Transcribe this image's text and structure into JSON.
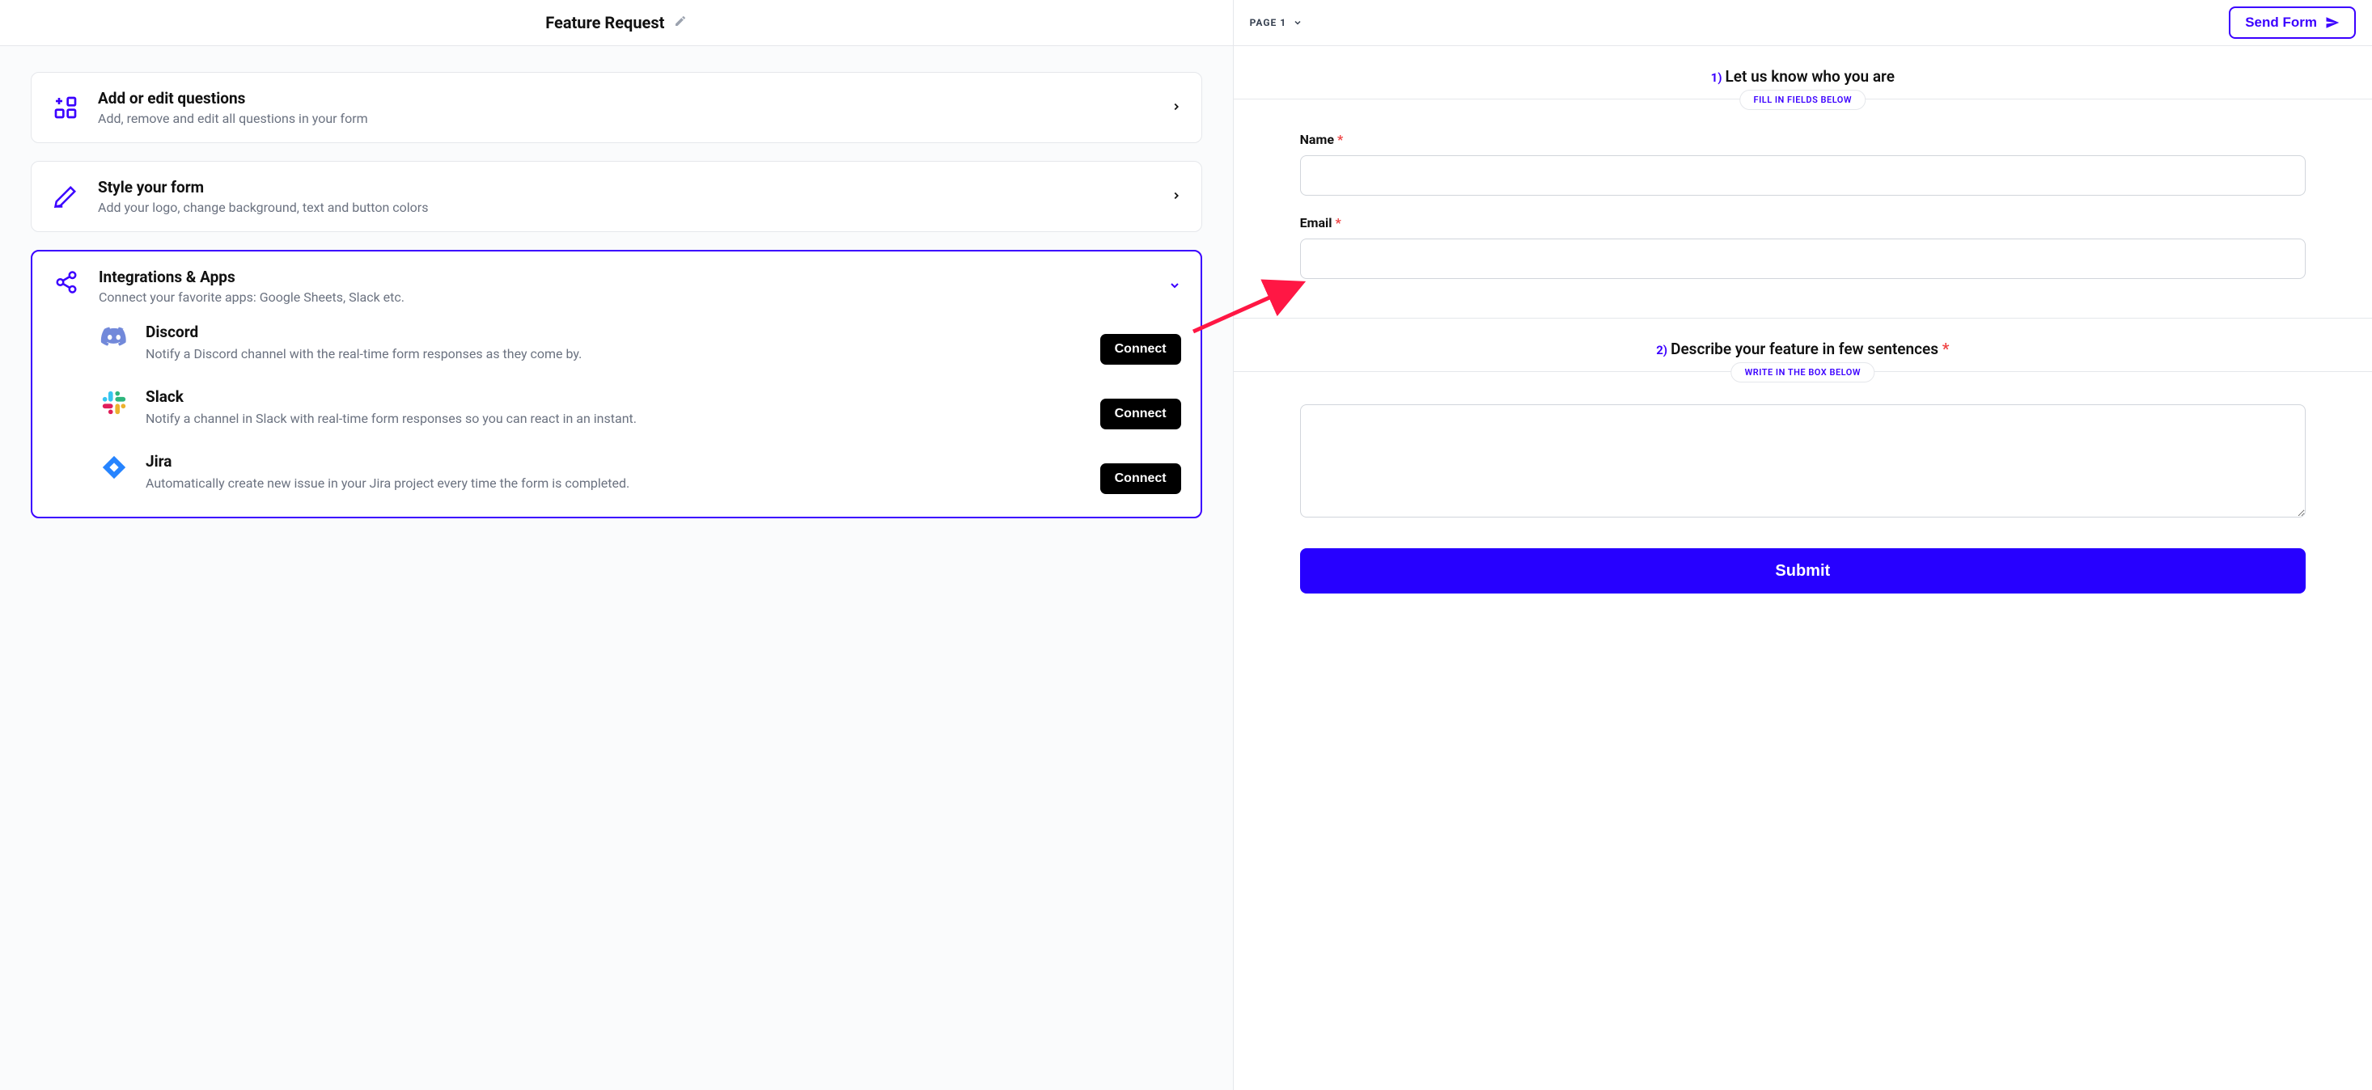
{
  "header": {
    "form_title": "Feature Request",
    "page_label": "PAGE 1",
    "send_form_label": "Send Form"
  },
  "left": {
    "cards": {
      "questions": {
        "title": "Add or edit questions",
        "subtitle": "Add, remove and edit all questions in your form"
      },
      "style": {
        "title": "Style your form",
        "subtitle": "Add your logo, change background, text and button colors"
      },
      "integrations": {
        "title": "Integrations & Apps",
        "subtitle": "Connect your favorite apps: Google Sheets, Slack etc."
      }
    },
    "integrations": [
      {
        "name": "Discord",
        "description": "Notify a Discord channel with the real-time form responses as they come by.",
        "button": "Connect"
      },
      {
        "name": "Slack",
        "description": "Notify a channel in Slack with real-time form responses so you can react in an instant.",
        "button": "Connect"
      },
      {
        "name": "Jira",
        "description": "Automatically create new issue in your Jira project every time the form is completed.",
        "button": "Connect"
      }
    ]
  },
  "right": {
    "section1": {
      "num": "1)",
      "title": "Let us know who you are",
      "pill": "FILL IN FIELDS BELOW",
      "name_label": "Name",
      "email_label": "Email"
    },
    "section2": {
      "num": "2)",
      "title": "Describe your feature in few sentences",
      "pill": "WRITE IN THE BOX BELOW"
    },
    "submit_label": "Submit"
  }
}
